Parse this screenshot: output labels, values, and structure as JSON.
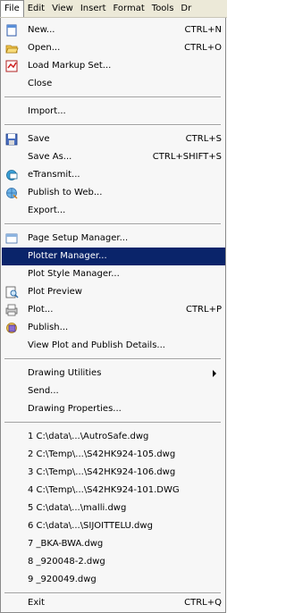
{
  "menubar": {
    "items": [
      "File",
      "Edit",
      "View",
      "Insert",
      "Format",
      "Tools",
      "Dr"
    ]
  },
  "menu": {
    "items": [
      {
        "label": "New...",
        "shortcut": "CTRL+N",
        "icon": "new-document-icon"
      },
      {
        "label": "Open...",
        "shortcut": "CTRL+O",
        "icon": "open-folder-icon"
      },
      {
        "label": "Load Markup Set...",
        "shortcut": "",
        "icon": "markup-set-icon"
      },
      {
        "label": "Close",
        "shortcut": ""
      },
      {
        "label": "Import...",
        "shortcut": ""
      },
      {
        "label": "Save",
        "shortcut": "CTRL+S",
        "icon": "save-disk-icon"
      },
      {
        "label": "Save As...",
        "shortcut": "CTRL+SHIFT+S"
      },
      {
        "label": "eTransmit...",
        "shortcut": "",
        "icon": "etransmit-icon"
      },
      {
        "label": "Publish to Web...",
        "shortcut": "",
        "icon": "publish-web-icon"
      },
      {
        "label": "Export...",
        "shortcut": ""
      },
      {
        "label": "Page Setup Manager...",
        "shortcut": "",
        "icon": "page-setup-icon"
      },
      {
        "label": "Plotter Manager...",
        "shortcut": ""
      },
      {
        "label": "Plot Style Manager...",
        "shortcut": ""
      },
      {
        "label": "Plot Preview",
        "shortcut": "",
        "icon": "plot-preview-icon"
      },
      {
        "label": "Plot...",
        "shortcut": "CTRL+P",
        "icon": "plot-icon"
      },
      {
        "label": "Publish...",
        "shortcut": "",
        "icon": "publish-icon"
      },
      {
        "label": "View Plot and Publish Details...",
        "shortcut": ""
      },
      {
        "label": "Drawing Utilities",
        "shortcut": ""
      },
      {
        "label": "Send...",
        "shortcut": ""
      },
      {
        "label": "Drawing Properties...",
        "shortcut": ""
      },
      {
        "label": "1 C:\\data\\...\\AutroSafe.dwg",
        "shortcut": ""
      },
      {
        "label": "2 C:\\Temp\\...\\S42HK924-105.dwg",
        "shortcut": ""
      },
      {
        "label": "3 C:\\Temp\\...\\S42HK924-106.dwg",
        "shortcut": ""
      },
      {
        "label": "4 C:\\Temp\\...\\S42HK924-101.DWG",
        "shortcut": ""
      },
      {
        "label": "5 C:\\data\\...\\malli.dwg",
        "shortcut": ""
      },
      {
        "label": "6 C:\\data\\...\\SIJOITTELU.dwg",
        "shortcut": ""
      },
      {
        "label": "7 _BKA-BWA.dwg",
        "shortcut": ""
      },
      {
        "label": "8 _920048-2.dwg",
        "shortcut": ""
      },
      {
        "label": "9 _920049.dwg",
        "shortcut": ""
      },
      {
        "label": "Exit",
        "shortcut": "CTRL+Q"
      }
    ]
  },
  "colors": {
    "highlight": "#0a246a",
    "menubar": "#ece9d8",
    "menu_bg": "#f7f7f7"
  }
}
